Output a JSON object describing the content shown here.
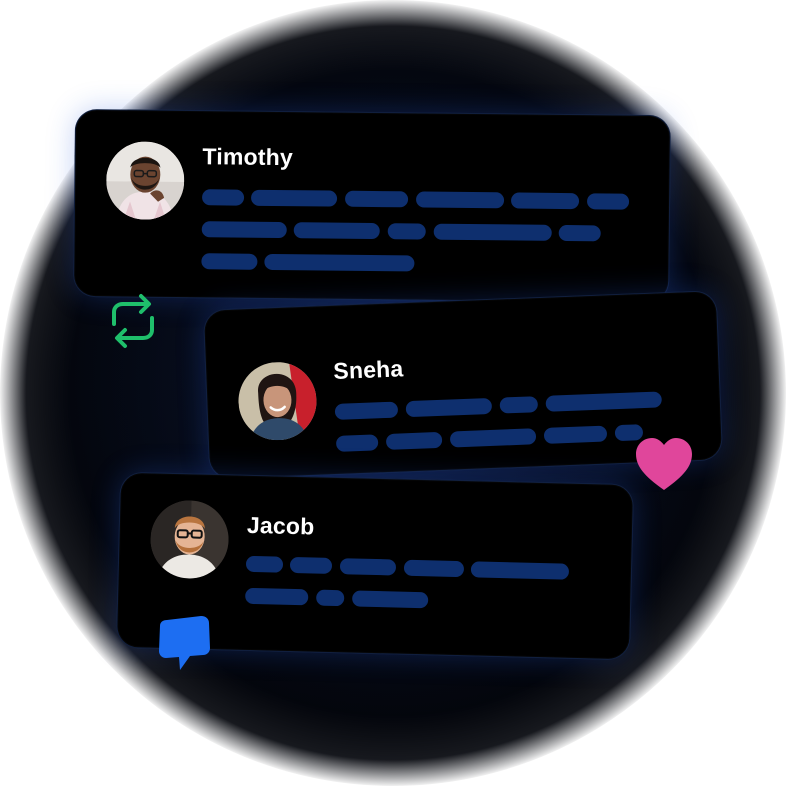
{
  "posts": [
    {
      "author": "Timothy"
    },
    {
      "author": "Sneha"
    },
    {
      "author": "Jacob"
    }
  ],
  "icons": {
    "repost": "repost-icon",
    "like": "heart-icon",
    "comment": "chat-bubble-icon"
  },
  "colors": {
    "card_background": "#000000",
    "text_placeholder": "#0e2f6e",
    "repost": "#1fbf6b",
    "like": "#e0469b",
    "comment": "#1d6ef2"
  }
}
